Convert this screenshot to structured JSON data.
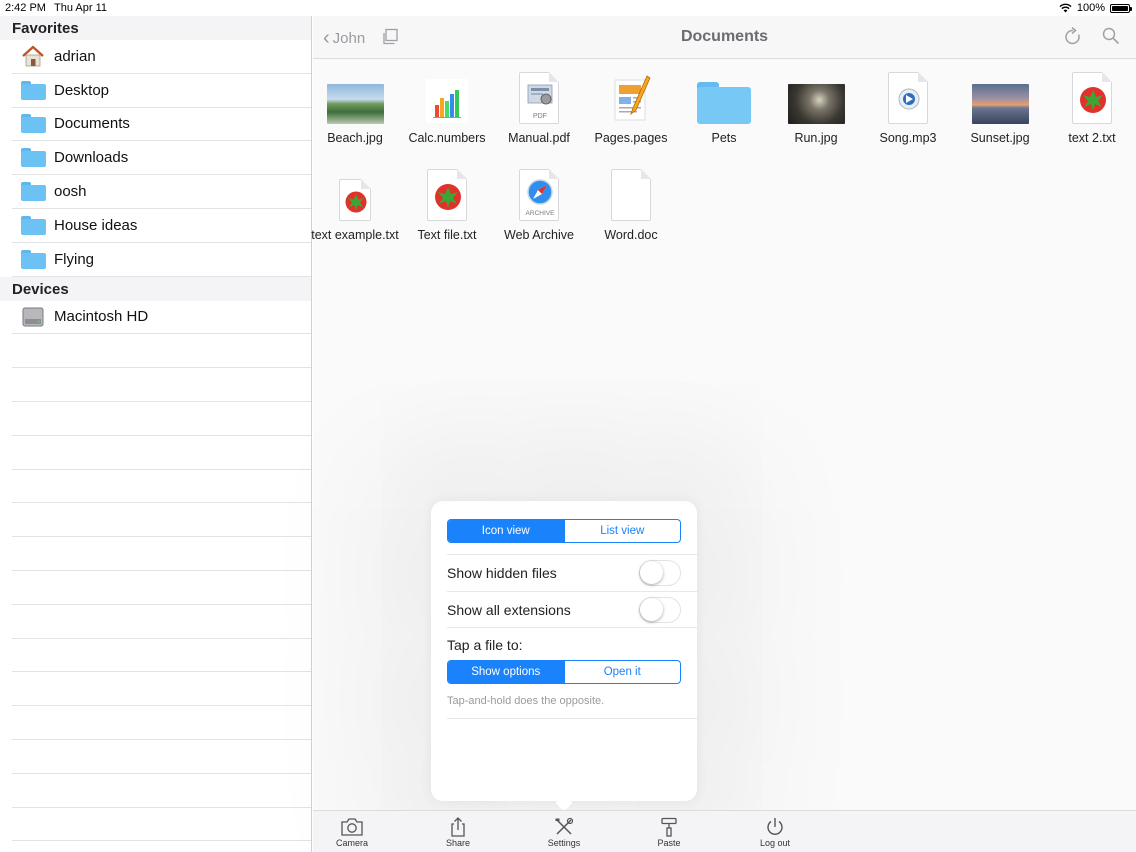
{
  "status_bar": {
    "time": "2:42 PM",
    "date": "Thu Apr 11",
    "battery": "100%"
  },
  "sidebar": {
    "favorites_header": "Favorites",
    "favorites": [
      {
        "label": "adrian",
        "icon": "home-icon"
      },
      {
        "label": "Desktop",
        "icon": "folder-icon"
      },
      {
        "label": "Documents",
        "icon": "folder-icon"
      },
      {
        "label": "Downloads",
        "icon": "folder-icon"
      },
      {
        "label": "oosh",
        "icon": "folder-icon"
      },
      {
        "label": "House ideas",
        "icon": "folder-icon"
      },
      {
        "label": "Flying",
        "icon": "folder-icon"
      }
    ],
    "devices_header": "Devices",
    "devices": [
      {
        "label": "Macintosh HD",
        "icon": "hard-drive-icon"
      }
    ]
  },
  "nav": {
    "back_label": "John",
    "title": "Documents"
  },
  "files": [
    {
      "name": "Beach.jpg",
      "kind": "photo"
    },
    {
      "name": "Calc.numbers",
      "kind": "numbers"
    },
    {
      "name": "Manual.pdf",
      "kind": "pdf",
      "badge": "PDF"
    },
    {
      "name": "Pages.pages",
      "kind": "pages"
    },
    {
      "name": "Pets",
      "kind": "folder"
    },
    {
      "name": "Run.jpg",
      "kind": "photo"
    },
    {
      "name": "Song.mp3",
      "kind": "audio"
    },
    {
      "name": "Sunset.jpg",
      "kind": "photo"
    },
    {
      "name": "text 2.txt",
      "kind": "text"
    },
    {
      "name": "text example.txt",
      "kind": "text"
    },
    {
      "name": "Text file.txt",
      "kind": "text"
    },
    {
      "name": "Web Archive",
      "kind": "archive",
      "badge": "ARCHIVE"
    },
    {
      "name": "Word.doc",
      "kind": "blank"
    }
  ],
  "popover": {
    "view_segment": {
      "options": [
        "Icon view",
        "List view"
      ],
      "selected": "Icon view"
    },
    "show_hidden_files": {
      "label": "Show hidden files",
      "on": false
    },
    "show_all_extensions": {
      "label": "Show all extensions",
      "on": false
    },
    "tap_label": "Tap a file to:",
    "tap_segment": {
      "options": [
        "Show options",
        "Open it"
      ],
      "selected": "Show options"
    },
    "hint": "Tap-and-hold does the opposite."
  },
  "toolbar": {
    "camera": "Camera",
    "share": "Share",
    "settings": "Settings",
    "paste": "Paste",
    "logout": "Log out"
  },
  "colors": {
    "accent": "#1a82fb",
    "folder": "#6cc3f3",
    "tomato_red": "#e2302a",
    "tomato_green": "#3da535"
  }
}
